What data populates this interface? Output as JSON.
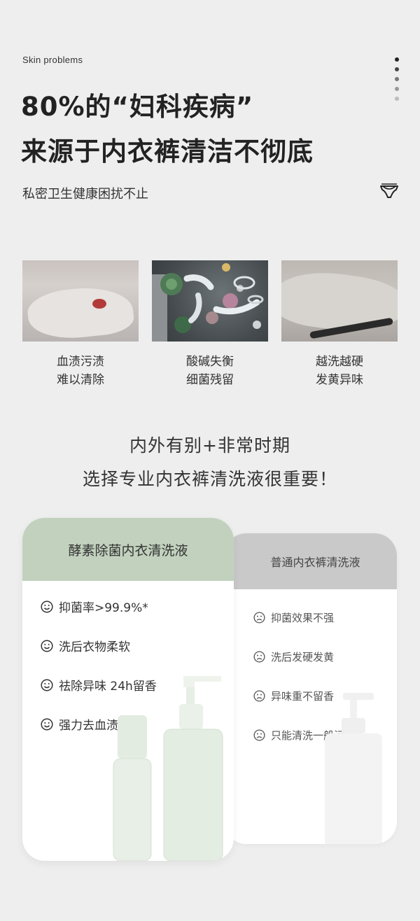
{
  "eyebrow": "Skin problems",
  "headline": {
    "line1": "80%的“妇科疾病”",
    "line2": "来源于内衣裤清洁不彻底"
  },
  "subline": "私密卫生健康困扰不止",
  "icons": {
    "pagination": "pagination-dots-icon",
    "briefs": "briefs-icon",
    "smile": "smile-face-icon",
    "frown": "frown-face-icon"
  },
  "colors": {
    "page_bg": "#eeeeee",
    "premium_header": "#c1d1bd",
    "ordinary_header": "#c9c9c9",
    "text_dark": "#222222"
  },
  "problems": [
    {
      "line1": "血渍污渍",
      "line2": "难以清除",
      "image": "stained underwear photo"
    },
    {
      "line1": "酸碱失衡",
      "line2": "细菌残留",
      "image": "bacteria illustration"
    },
    {
      "line1": "越洗越硬",
      "line2": "发黄异味",
      "image": "worn fabric photo"
    }
  ],
  "middle": {
    "line1": "内外有别+非常时期",
    "line2": "选择专业内衣裤清洗液很重要！"
  },
  "premium": {
    "title": "酵素除菌内衣清洗液",
    "features": [
      "抑菌率>99.9%*",
      "洗后衣物柔软",
      "祛除异味 24h留香",
      "强力去血渍/黄渍"
    ]
  },
  "ordinary": {
    "title": "普通内衣裤清洗液",
    "features": [
      "抑菌效果不强",
      "洗后发硬发黄",
      "异味重不留香",
      "只能清洗一般污渍"
    ]
  }
}
